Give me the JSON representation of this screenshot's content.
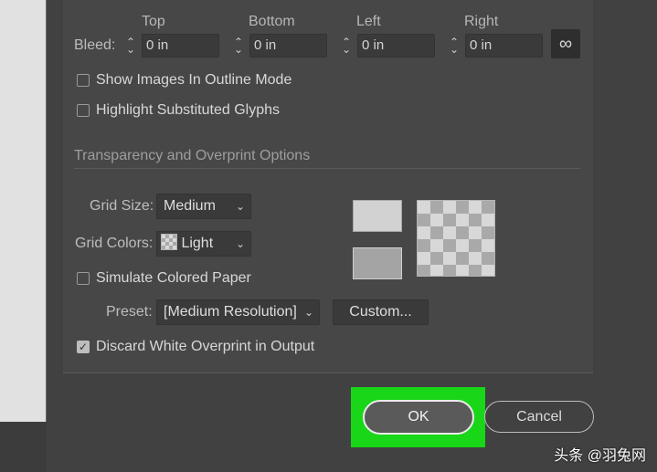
{
  "bleed": {
    "label": "Bleed:",
    "columns": [
      "Top",
      "Bottom",
      "Left",
      "Right"
    ],
    "values": [
      "0 in",
      "0 in",
      "0 in",
      "0 in"
    ]
  },
  "display_options": {
    "show_images_outline": "Show Images In Outline Mode",
    "highlight_glyphs": "Highlight Substituted Glyphs"
  },
  "transparency": {
    "section_title": "Transparency and Overprint Options",
    "grid_size_label": "Grid Size:",
    "grid_size_value": "Medium",
    "grid_colors_label": "Grid Colors:",
    "grid_colors_value": "Light",
    "simulate_paper": "Simulate Colored Paper",
    "preset_label": "Preset:",
    "preset_value": "[Medium Resolution]",
    "custom_button": "Custom...",
    "discard_overprint": "Discard White Overprint in Output"
  },
  "buttons": {
    "ok": "OK",
    "cancel": "Cancel"
  },
  "watermark": "头条 @羽兔网",
  "colors": {
    "highlight": "#19d619"
  }
}
